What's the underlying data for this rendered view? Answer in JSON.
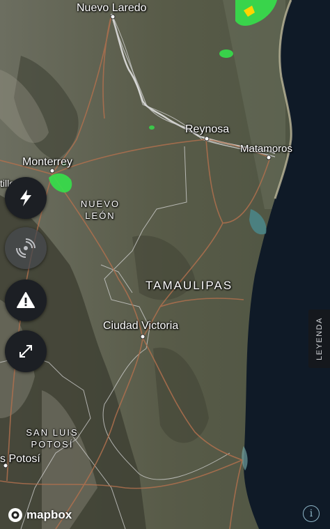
{
  "map": {
    "cities": [
      {
        "name": "Nuevo Laredo"
      },
      {
        "name": "Reynosa"
      },
      {
        "name": "Matamoros"
      },
      {
        "name": "Monterrey"
      },
      {
        "name": "Ciudad Victoria"
      },
      {
        "name": "s Potosí"
      },
      {
        "name": "tillo"
      }
    ],
    "states": {
      "nuevo_leon_line1": "NUEVO",
      "nuevo_leon_line2": "LEÓN",
      "tamaulipas": "TAMAULIPAS",
      "slp_line1": "SAN LUIS",
      "slp_line2": "POTOSÍ"
    }
  },
  "controls": {
    "lightning_icon": "lightning-icon",
    "radar_icon": "radar-icon",
    "alert_icon": "warning-triangle-icon",
    "expand_icon": "expand-icon",
    "radar_enabled": false
  },
  "legend": {
    "label": "LEYENDA"
  },
  "attribution": {
    "brand": "mapbox",
    "info_glyph": "i"
  },
  "colors": {
    "land": "#5b5e4d",
    "ocean": "#0f1a27",
    "roads": "#b0704e",
    "borders": "#d8d8d8",
    "radar_green": "#35e04a",
    "radar_yellow": "#ffd400"
  }
}
